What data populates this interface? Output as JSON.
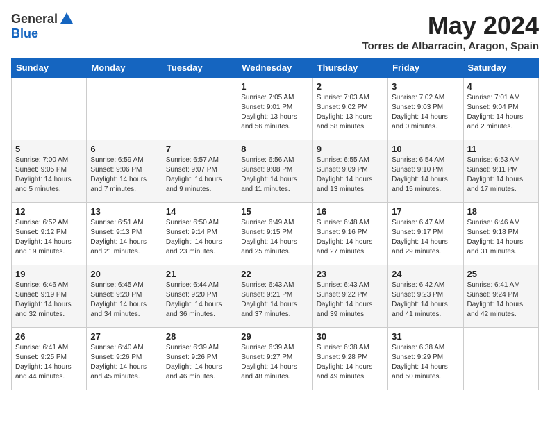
{
  "header": {
    "logo_general": "General",
    "logo_blue": "Blue",
    "month_title": "May 2024",
    "location": "Torres de Albarracin, Aragon, Spain"
  },
  "weekdays": [
    "Sunday",
    "Monday",
    "Tuesday",
    "Wednesday",
    "Thursday",
    "Friday",
    "Saturday"
  ],
  "weeks": [
    [
      {
        "day": "",
        "info": ""
      },
      {
        "day": "",
        "info": ""
      },
      {
        "day": "",
        "info": ""
      },
      {
        "day": "1",
        "info": "Sunrise: 7:05 AM\nSunset: 9:01 PM\nDaylight: 13 hours and 56 minutes."
      },
      {
        "day": "2",
        "info": "Sunrise: 7:03 AM\nSunset: 9:02 PM\nDaylight: 13 hours and 58 minutes."
      },
      {
        "day": "3",
        "info": "Sunrise: 7:02 AM\nSunset: 9:03 PM\nDaylight: 14 hours and 0 minutes."
      },
      {
        "day": "4",
        "info": "Sunrise: 7:01 AM\nSunset: 9:04 PM\nDaylight: 14 hours and 2 minutes."
      }
    ],
    [
      {
        "day": "5",
        "info": "Sunrise: 7:00 AM\nSunset: 9:05 PM\nDaylight: 14 hours and 5 minutes."
      },
      {
        "day": "6",
        "info": "Sunrise: 6:59 AM\nSunset: 9:06 PM\nDaylight: 14 hours and 7 minutes."
      },
      {
        "day": "7",
        "info": "Sunrise: 6:57 AM\nSunset: 9:07 PM\nDaylight: 14 hours and 9 minutes."
      },
      {
        "day": "8",
        "info": "Sunrise: 6:56 AM\nSunset: 9:08 PM\nDaylight: 14 hours and 11 minutes."
      },
      {
        "day": "9",
        "info": "Sunrise: 6:55 AM\nSunset: 9:09 PM\nDaylight: 14 hours and 13 minutes."
      },
      {
        "day": "10",
        "info": "Sunrise: 6:54 AM\nSunset: 9:10 PM\nDaylight: 14 hours and 15 minutes."
      },
      {
        "day": "11",
        "info": "Sunrise: 6:53 AM\nSunset: 9:11 PM\nDaylight: 14 hours and 17 minutes."
      }
    ],
    [
      {
        "day": "12",
        "info": "Sunrise: 6:52 AM\nSunset: 9:12 PM\nDaylight: 14 hours and 19 minutes."
      },
      {
        "day": "13",
        "info": "Sunrise: 6:51 AM\nSunset: 9:13 PM\nDaylight: 14 hours and 21 minutes."
      },
      {
        "day": "14",
        "info": "Sunrise: 6:50 AM\nSunset: 9:14 PM\nDaylight: 14 hours and 23 minutes."
      },
      {
        "day": "15",
        "info": "Sunrise: 6:49 AM\nSunset: 9:15 PM\nDaylight: 14 hours and 25 minutes."
      },
      {
        "day": "16",
        "info": "Sunrise: 6:48 AM\nSunset: 9:16 PM\nDaylight: 14 hours and 27 minutes."
      },
      {
        "day": "17",
        "info": "Sunrise: 6:47 AM\nSunset: 9:17 PM\nDaylight: 14 hours and 29 minutes."
      },
      {
        "day": "18",
        "info": "Sunrise: 6:46 AM\nSunset: 9:18 PM\nDaylight: 14 hours and 31 minutes."
      }
    ],
    [
      {
        "day": "19",
        "info": "Sunrise: 6:46 AM\nSunset: 9:19 PM\nDaylight: 14 hours and 32 minutes."
      },
      {
        "day": "20",
        "info": "Sunrise: 6:45 AM\nSunset: 9:20 PM\nDaylight: 14 hours and 34 minutes."
      },
      {
        "day": "21",
        "info": "Sunrise: 6:44 AM\nSunset: 9:20 PM\nDaylight: 14 hours and 36 minutes."
      },
      {
        "day": "22",
        "info": "Sunrise: 6:43 AM\nSunset: 9:21 PM\nDaylight: 14 hours and 37 minutes."
      },
      {
        "day": "23",
        "info": "Sunrise: 6:43 AM\nSunset: 9:22 PM\nDaylight: 14 hours and 39 minutes."
      },
      {
        "day": "24",
        "info": "Sunrise: 6:42 AM\nSunset: 9:23 PM\nDaylight: 14 hours and 41 minutes."
      },
      {
        "day": "25",
        "info": "Sunrise: 6:41 AM\nSunset: 9:24 PM\nDaylight: 14 hours and 42 minutes."
      }
    ],
    [
      {
        "day": "26",
        "info": "Sunrise: 6:41 AM\nSunset: 9:25 PM\nDaylight: 14 hours and 44 minutes."
      },
      {
        "day": "27",
        "info": "Sunrise: 6:40 AM\nSunset: 9:26 PM\nDaylight: 14 hours and 45 minutes."
      },
      {
        "day": "28",
        "info": "Sunrise: 6:39 AM\nSunset: 9:26 PM\nDaylight: 14 hours and 46 minutes."
      },
      {
        "day": "29",
        "info": "Sunrise: 6:39 AM\nSunset: 9:27 PM\nDaylight: 14 hours and 48 minutes."
      },
      {
        "day": "30",
        "info": "Sunrise: 6:38 AM\nSunset: 9:28 PM\nDaylight: 14 hours and 49 minutes."
      },
      {
        "day": "31",
        "info": "Sunrise: 6:38 AM\nSunset: 9:29 PM\nDaylight: 14 hours and 50 minutes."
      },
      {
        "day": "",
        "info": ""
      }
    ]
  ]
}
